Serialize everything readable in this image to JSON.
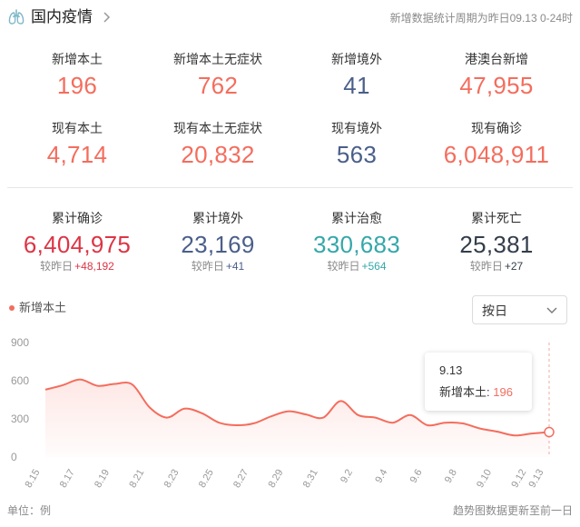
{
  "header": {
    "title": "国内疫情",
    "period_note": "新增数据统计周期为昨日09.13 0-24时"
  },
  "stats_row1": [
    {
      "label": "新增本土",
      "value": "196",
      "color": "#f46d5d"
    },
    {
      "label": "新增本土无症状",
      "value": "762",
      "color": "#f46d5d"
    },
    {
      "label": "新增境外",
      "value": "41",
      "color": "#4a5f8a"
    },
    {
      "label": "港澳台新增",
      "value": "47,955",
      "color": "#f46d5d"
    }
  ],
  "stats_row2": [
    {
      "label": "现有本土",
      "value": "4,714",
      "color": "#f46d5d"
    },
    {
      "label": "现有本土无症状",
      "value": "20,832",
      "color": "#f46d5d"
    },
    {
      "label": "现有境外",
      "value": "563",
      "color": "#4a5f8a"
    },
    {
      "label": "现有确诊",
      "value": "6,048,911",
      "color": "#f46d5d"
    }
  ],
  "stats_row3": [
    {
      "label": "累计确诊",
      "value": "6,404,975",
      "delta_label": "较昨日",
      "delta": "+48,192",
      "color": "#dc3545"
    },
    {
      "label": "累计境外",
      "value": "23,169",
      "delta_label": "较昨日",
      "delta": "+41",
      "color": "#4a5f8a"
    },
    {
      "label": "累计治愈",
      "value": "330,683",
      "delta_label": "较昨日",
      "delta": "+564",
      "color": "#35a7a9"
    },
    {
      "label": "累计死亡",
      "value": "25,381",
      "delta_label": "较昨日",
      "delta": "+27",
      "color": "#333d4a"
    }
  ],
  "chart_section": {
    "legend_label": "新增本土",
    "period_select": "按日",
    "unit_label": "单位：例",
    "footer_note": "趋势图数据更新至前一日"
  },
  "tooltip": {
    "date": "9.13",
    "label": "新增本土:",
    "value": "196"
  },
  "chart_data": {
    "type": "area",
    "title": "",
    "xlabel": "",
    "ylabel": "",
    "ylim": [
      0,
      900
    ],
    "yticks": [
      0,
      300,
      600,
      900
    ],
    "grid": false,
    "legend": "top-left",
    "color": "#f46d5d",
    "x": [
      "8.15",
      "8.16",
      "8.17",
      "8.18",
      "8.19",
      "8.20",
      "8.21",
      "8.22",
      "8.23",
      "8.24",
      "8.25",
      "8.26",
      "8.27",
      "8.28",
      "8.29",
      "8.30",
      "8.31",
      "9.1",
      "9.2",
      "9.3",
      "9.4",
      "9.5",
      "9.6",
      "9.7",
      "9.8",
      "9.9",
      "9.10",
      "9.11",
      "9.12",
      "9.13"
    ],
    "xtick_labels": [
      "8.15",
      "8.17",
      "8.19",
      "8.21",
      "8.23",
      "8.25",
      "8.27",
      "8.29",
      "8.31",
      "9.2",
      "9.4",
      "9.6",
      "9.8",
      "9.10",
      "9.12",
      "9.13"
    ],
    "series": [
      {
        "name": "新增本土",
        "values": [
          530,
          565,
          610,
          560,
          575,
          570,
          390,
          310,
          380,
          345,
          270,
          250,
          265,
          320,
          360,
          335,
          310,
          440,
          330,
          310,
          270,
          330,
          250,
          270,
          265,
          225,
          200,
          170,
          185,
          196
        ]
      }
    ]
  }
}
